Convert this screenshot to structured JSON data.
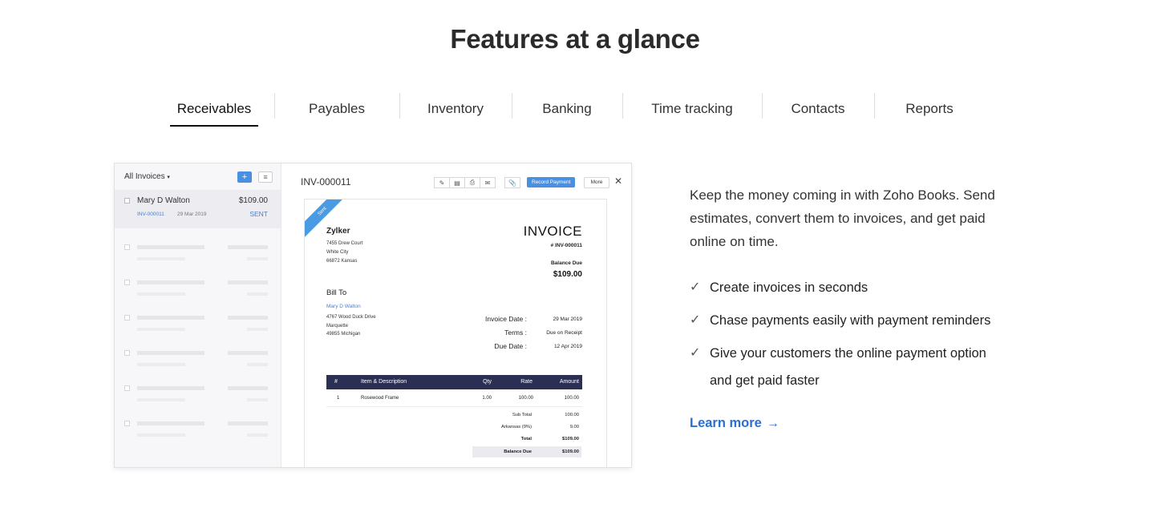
{
  "heading": "Features at a glance",
  "tabs": [
    {
      "label": "Receivables",
      "active": true
    },
    {
      "label": "Payables"
    },
    {
      "label": "Inventory"
    },
    {
      "label": "Banking"
    },
    {
      "label": "Time tracking"
    },
    {
      "label": "Contacts"
    },
    {
      "label": "Reports"
    }
  ],
  "mockup": {
    "list_filter": "All Invoices",
    "list_item": {
      "name": "Mary D Walton",
      "amount": "$109.00",
      "number": "INV-000011",
      "date": "29 Mar 2019",
      "status": "SENT"
    },
    "invoice_id": "INV-000011",
    "record_payment": "Record Payment",
    "more": "More",
    "ribbon": "Sent",
    "company": "Zylker",
    "company_address": [
      "7455 Drew Court",
      "White City",
      "66872 Kansas"
    ],
    "title": "INVOICE",
    "number": "# INV-000011",
    "balance_due_label": "Balance Due",
    "balance_due_amount": "$109.00",
    "bill_to": "Bill To",
    "customer": "Mary D Walton",
    "customer_address": [
      "4767 Wood Duck Drive",
      "Marquette",
      "49855 Michigan"
    ],
    "invoice_date_label": "Invoice Date :",
    "invoice_date": "29 Mar 2019",
    "terms_label": "Terms :",
    "terms": "Due on Receipt",
    "due_date_label": "Due Date :",
    "due_date": "12 Apr 2019",
    "table_headers": {
      "num": "#",
      "item": "Item & Description",
      "qty": "Qty",
      "rate": "Rate",
      "amount": "Amount"
    },
    "items": [
      {
        "num": "1",
        "item": "Rosewood Frame",
        "qty": "1.00",
        "rate": "100.00",
        "amount": "100.00"
      }
    ],
    "totals": [
      {
        "label": "Sub Total",
        "value": "100.00"
      },
      {
        "label": "Arkansas (9%)",
        "value": "9.00"
      },
      {
        "label": "Total",
        "value": "$109.00"
      },
      {
        "label": "Balance Due",
        "value": "$109.00"
      }
    ]
  },
  "description": "Keep the money coming in with Zoho Books. Send estimates, convert them to invoices, and get paid online on time.",
  "features": [
    "Create invoices in seconds",
    "Chase payments easily with payment reminders",
    "Give your customers the online payment option and get paid faster"
  ],
  "learn_more": "Learn more",
  "icons": {
    "check": "check-icon",
    "arrow": "arrow-right-icon"
  },
  "colors": {
    "accent": "#2c6fcf",
    "button_blue": "#4a90e2",
    "table_header": "#2c2f54"
  }
}
